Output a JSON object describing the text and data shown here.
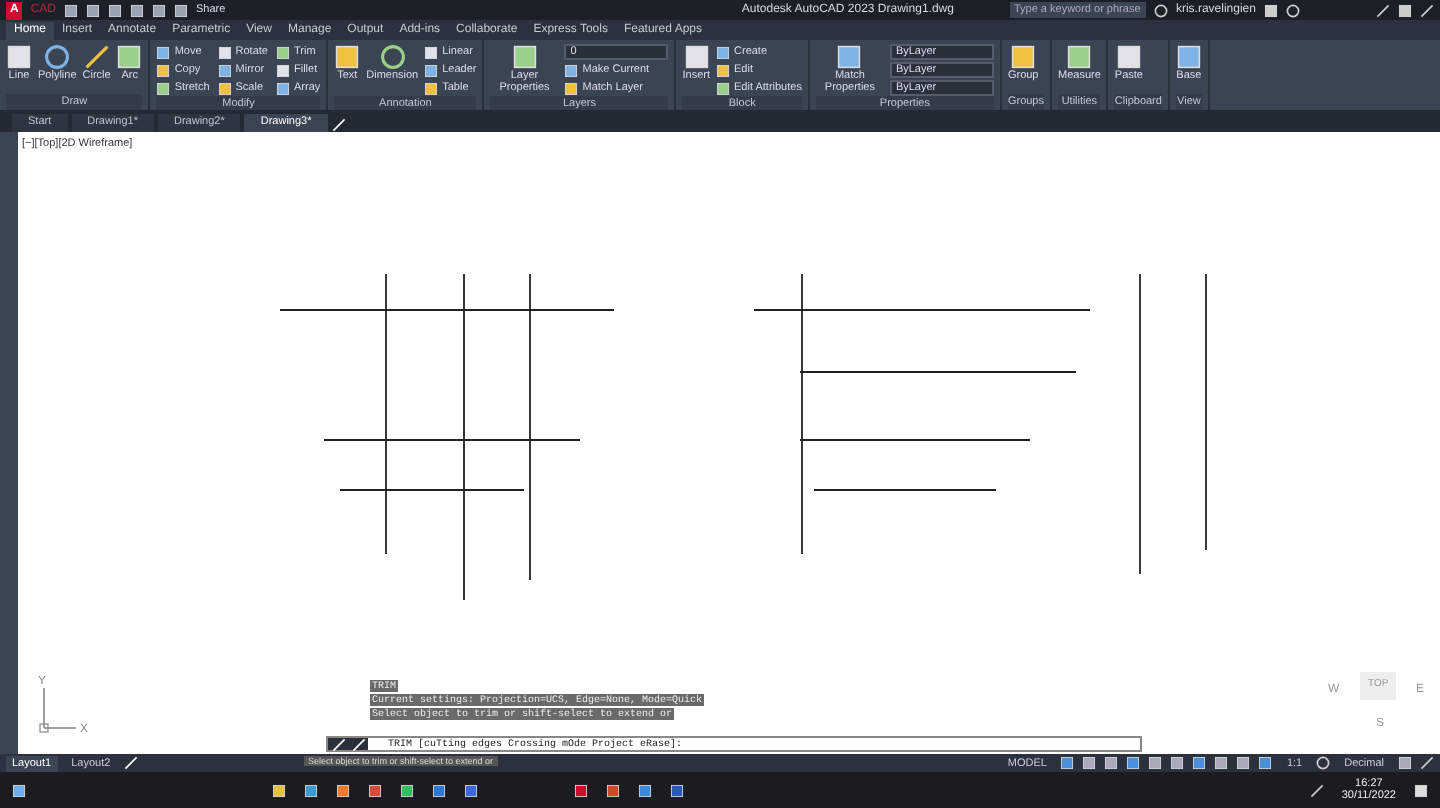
{
  "title_bar": {
    "app_logo": "A",
    "app_badge": "CAD",
    "share": "Share",
    "title": "Autodesk AutoCAD 2023  Drawing1.dwg",
    "search": {
      "placeholder": "Type a keyword or phrase"
    },
    "user": "kris.ravelingien"
  },
  "ribbon_tabs": [
    {
      "label": "Home",
      "selected": true
    },
    {
      "label": "Insert",
      "selected": false
    },
    {
      "label": "Annotate",
      "selected": false
    },
    {
      "label": "Parametric",
      "selected": false
    },
    {
      "label": "View",
      "selected": false
    },
    {
      "label": "Manage",
      "selected": false
    },
    {
      "label": "Output",
      "selected": false
    },
    {
      "label": "Add-ins",
      "selected": false
    },
    {
      "label": "Collaborate",
      "selected": false
    },
    {
      "label": "Express Tools",
      "selected": false
    },
    {
      "label": "Featured Apps",
      "selected": false
    }
  ],
  "panels": [
    {
      "title": "Draw",
      "items": [
        {
          "kind": "large",
          "label": "Line"
        },
        {
          "kind": "large",
          "label": "Polyline"
        },
        {
          "kind": "large",
          "label": "Circle"
        },
        {
          "kind": "large",
          "label": "Arc"
        }
      ]
    },
    {
      "title": "Modify",
      "items": [
        {
          "kind": "small",
          "label": "Move"
        },
        {
          "kind": "small",
          "label": "Copy"
        },
        {
          "kind": "small",
          "label": "Stretch"
        },
        {
          "kind": "small",
          "label": "Rotate"
        },
        {
          "kind": "small",
          "label": "Mirror"
        },
        {
          "kind": "small",
          "label": "Scale"
        },
        {
          "kind": "small",
          "label": "Trim"
        },
        {
          "kind": "small",
          "label": "Fillet"
        },
        {
          "kind": "small",
          "label": "Array"
        }
      ]
    },
    {
      "title": "Annotation",
      "items": [
        {
          "kind": "large",
          "label": "Text"
        },
        {
          "kind": "large",
          "label": "Dimension"
        },
        {
          "kind": "small",
          "label": "Linear"
        },
        {
          "kind": "small",
          "label": "Leader"
        },
        {
          "kind": "small",
          "label": "Table"
        }
      ]
    },
    {
      "title": "Layers",
      "items": [
        {
          "kind": "large",
          "label": "Layer Properties"
        },
        {
          "kind": "combo",
          "label": "0"
        },
        {
          "kind": "small",
          "label": "Make Current"
        },
        {
          "kind": "small",
          "label": "Match Layer"
        }
      ]
    },
    {
      "title": "Block",
      "items": [
        {
          "kind": "large",
          "label": "Insert"
        },
        {
          "kind": "small",
          "label": "Create"
        },
        {
          "kind": "small",
          "label": "Edit"
        },
        {
          "kind": "small",
          "label": "Edit Attributes"
        }
      ]
    },
    {
      "title": "Properties",
      "items": [
        {
          "kind": "large",
          "label": "Match Properties"
        },
        {
          "kind": "combo",
          "label": "ByLayer"
        },
        {
          "kind": "combo",
          "label": "ByLayer"
        },
        {
          "kind": "combo",
          "label": "ByLayer"
        }
      ]
    },
    {
      "title": "Groups",
      "items": [
        {
          "kind": "large",
          "label": "Group"
        }
      ]
    },
    {
      "title": "Utilities",
      "items": [
        {
          "kind": "large",
          "label": "Measure"
        }
      ]
    },
    {
      "title": "Clipboard",
      "items": [
        {
          "kind": "large",
          "label": "Paste"
        }
      ]
    },
    {
      "title": "View",
      "items": [
        {
          "kind": "large",
          "label": "Base"
        }
      ]
    }
  ],
  "file_tabs": [
    {
      "label": "Start",
      "selected": false
    },
    {
      "label": "Drawing1*",
      "selected": false
    },
    {
      "label": "Drawing2*",
      "selected": false
    },
    {
      "label": "Drawing3*",
      "selected": true
    }
  ],
  "viewport_label": "[−][Top][2D Wireframe]",
  "ucs": {
    "y": "Y",
    "x": "X"
  },
  "viewcube": {
    "west": "W",
    "top": "TOP",
    "east": "E",
    "south": "S"
  },
  "command_history": [
    "TRIM",
    "Current settings: Projection=UCS, Edge=None, Mode=Quick",
    "Select object to trim or shift-select to extend or"
  ],
  "command_line": "TRIM [cuTting edges Crossing mOde Project eRase]:",
  "tooltip": "Select object to trim or shift-select to extend or",
  "layout_tabs": [
    {
      "label": "Layout1",
      "selected": true
    },
    {
      "label": "Layout2",
      "selected": false
    }
  ],
  "status_bar": {
    "model": "MODEL",
    "scale": "1:1",
    "units": "Decimal"
  },
  "taskbar": {
    "time": "16:27",
    "date": "30/11/2022"
  }
}
